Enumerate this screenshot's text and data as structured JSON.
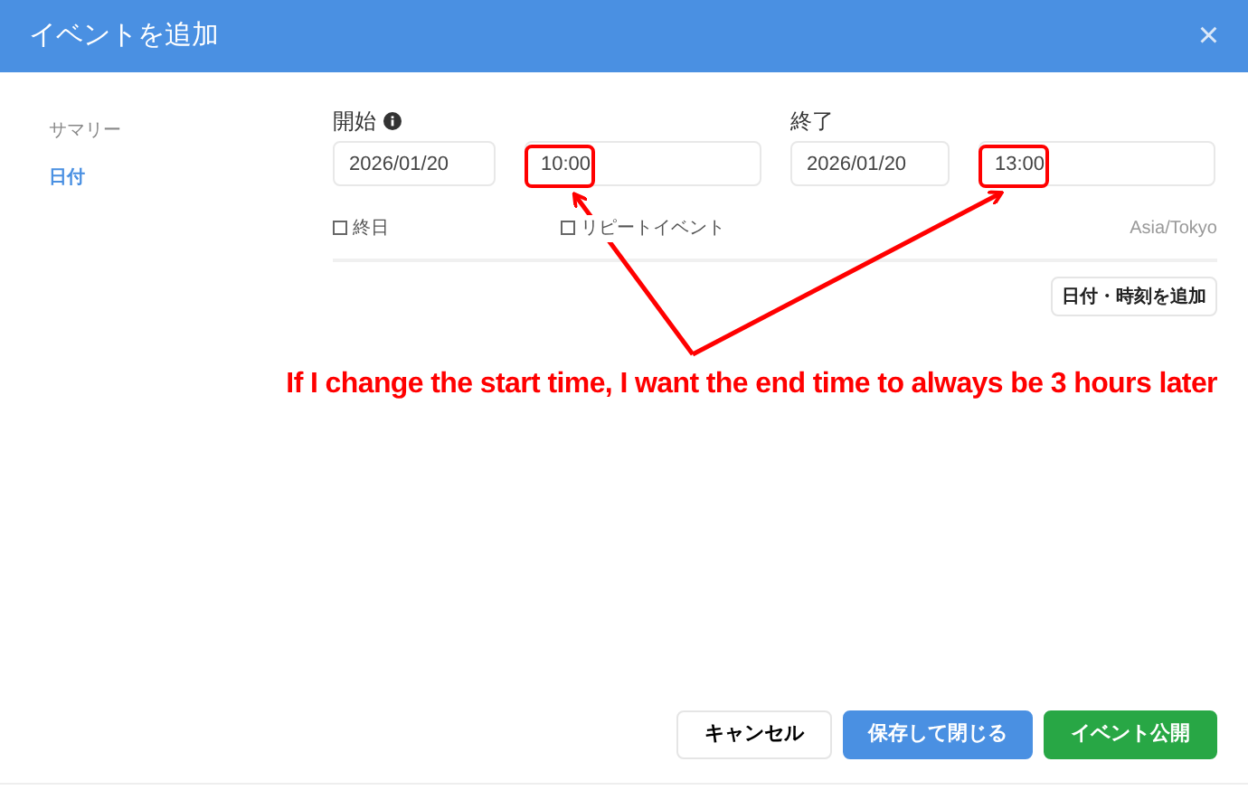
{
  "window": {
    "title": "イベントを追加",
    "close": "×"
  },
  "sidebar": {
    "items": [
      {
        "label": "サマリー",
        "selected": false
      },
      {
        "label": "日付",
        "selected": true
      }
    ]
  },
  "start": {
    "label": "開始",
    "date": "2026/01/20",
    "time": "10:00"
  },
  "end": {
    "label": "終了",
    "date": "2026/01/20",
    "time": "13:00"
  },
  "options": [
    {
      "label": "終日",
      "checked": false
    },
    {
      "label": "リピートイベント",
      "checked": false
    }
  ],
  "timezone": "Asia/Tokyo",
  "add_button": "日付・時刻を追加",
  "annotation": {
    "text": "If I change the start time, I want the end time to always be 3 hours later"
  },
  "buttons": [
    {
      "label": "キャンセル",
      "kind": "plain"
    },
    {
      "label": "保存して閉じる",
      "kind": "primary"
    },
    {
      "label": "イベント公開",
      "kind": "success"
    }
  ]
}
